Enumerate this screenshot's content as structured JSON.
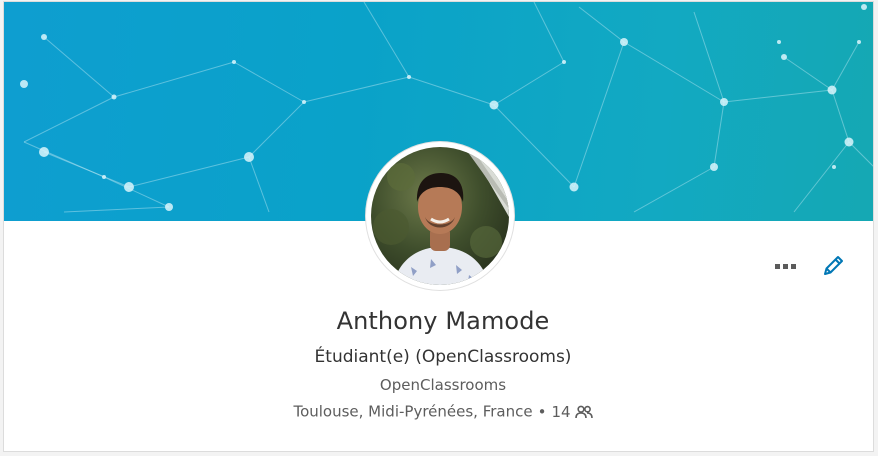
{
  "profile": {
    "name": "Anthony Mamode",
    "headline": "Étudiant(e) (OpenClassrooms)",
    "company": "OpenClassrooms",
    "location": "Toulouse, Midi-Pyrénées, France",
    "separator": "•",
    "connections": "14"
  },
  "icons": {
    "more": "ellipsis-icon",
    "edit": "pencil-icon",
    "connections": "people-icon"
  },
  "colors": {
    "banner_start": "#0e9ed0",
    "banner_end": "#15a8b3",
    "accent": "#0077b5",
    "text_primary": "#333333",
    "text_secondary": "#5d5d5d"
  }
}
